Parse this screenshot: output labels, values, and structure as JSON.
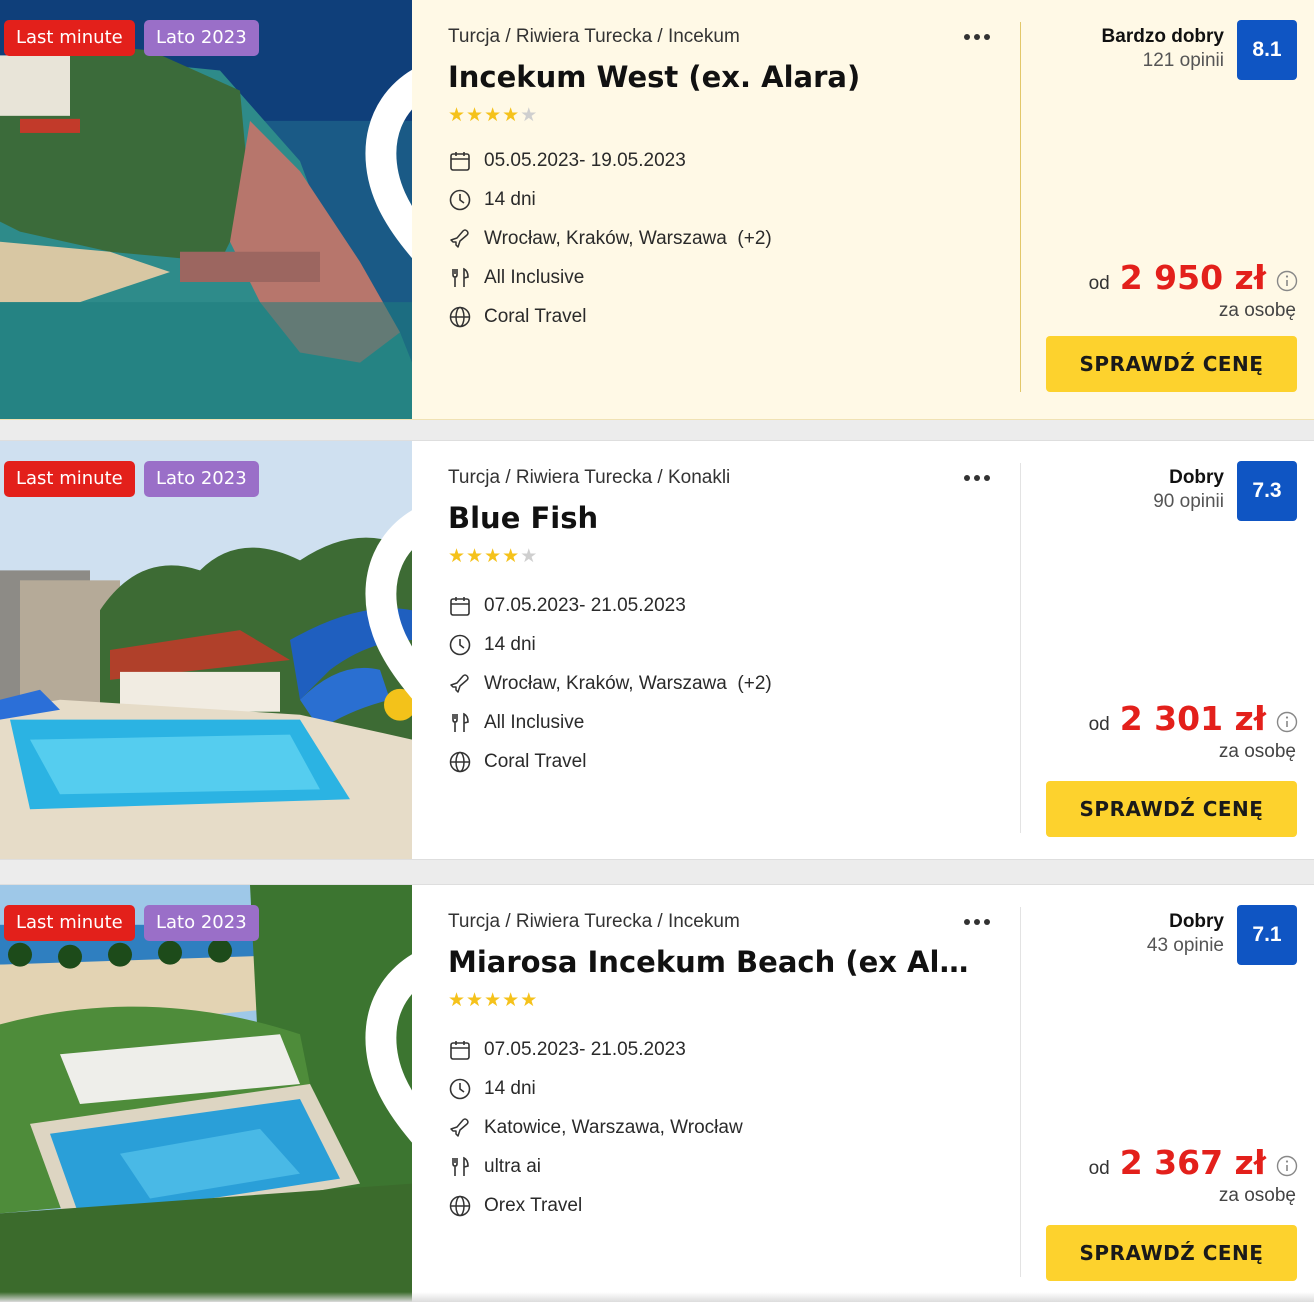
{
  "offers": [
    {
      "badges": [
        "Last minute",
        "Lato 2023"
      ],
      "breadcrumb": "Turcja / Riwiera Turecka / Incekum",
      "name": "Incekum West (ex. Alara)",
      "stars": 4,
      "dates": "05.05.2023- 19.05.2023",
      "duration": "14 dni",
      "departures": "Wrocław, Kraków, Warszawa  (+2)",
      "board": "All Inclusive",
      "operator": "Coral Travel",
      "rating_label": "Bardzo dobry",
      "reviews": "121 opinii",
      "score": "8.1",
      "price_prefix": "od",
      "price": "2 950 zł",
      "price_note": "za osobę",
      "cta": "SPRAWDŹ CENĘ",
      "highlighted": true
    },
    {
      "badges": [
        "Last minute",
        "Lato 2023"
      ],
      "breadcrumb": "Turcja / Riwiera Turecka / Konakli",
      "name": "Blue Fish",
      "stars": 4,
      "dates": "07.05.2023- 21.05.2023",
      "duration": "14 dni",
      "departures": "Wrocław, Kraków, Warszawa  (+2)",
      "board": "All Inclusive",
      "operator": "Coral Travel",
      "rating_label": "Dobry",
      "reviews": "90 opinii",
      "score": "7.3",
      "price_prefix": "od",
      "price": "2 301 zł",
      "price_note": "za osobę",
      "cta": "SPRAWDŹ CENĘ",
      "highlighted": false
    },
    {
      "badges": [
        "Last minute",
        "Lato 2023"
      ],
      "breadcrumb": "Turcja / Riwiera Turecka / Incekum",
      "name": "Miarosa Incekum Beach (ex Alara Ku...",
      "stars": 5,
      "dates": "07.05.2023- 21.05.2023",
      "duration": "14 dni",
      "departures": "Katowice, Warszawa, Wrocław",
      "board": "ultra ai",
      "operator": "Orex Travel",
      "rating_label": "Dobry",
      "reviews": "43 opinie",
      "score": "7.1",
      "price_prefix": "od",
      "price": "2 367 zł",
      "price_note": "za osobę",
      "cta": "SPRAWDŹ CENĘ",
      "highlighted": false
    }
  ],
  "colors": {
    "badge_last_minute": "#e3201b",
    "badge_season": "#9a6fc8",
    "score_bg": "#0f55c3",
    "price": "#e3201b",
    "cta_bg": "#fdd22d",
    "highlight_bg": "#fff9e6",
    "star": "#f5c21b"
  },
  "icons": [
    "heart-icon",
    "more-icon",
    "calendar-icon",
    "clock-icon",
    "plane-icon",
    "cutlery-icon",
    "globe-icon",
    "info-icon"
  ]
}
